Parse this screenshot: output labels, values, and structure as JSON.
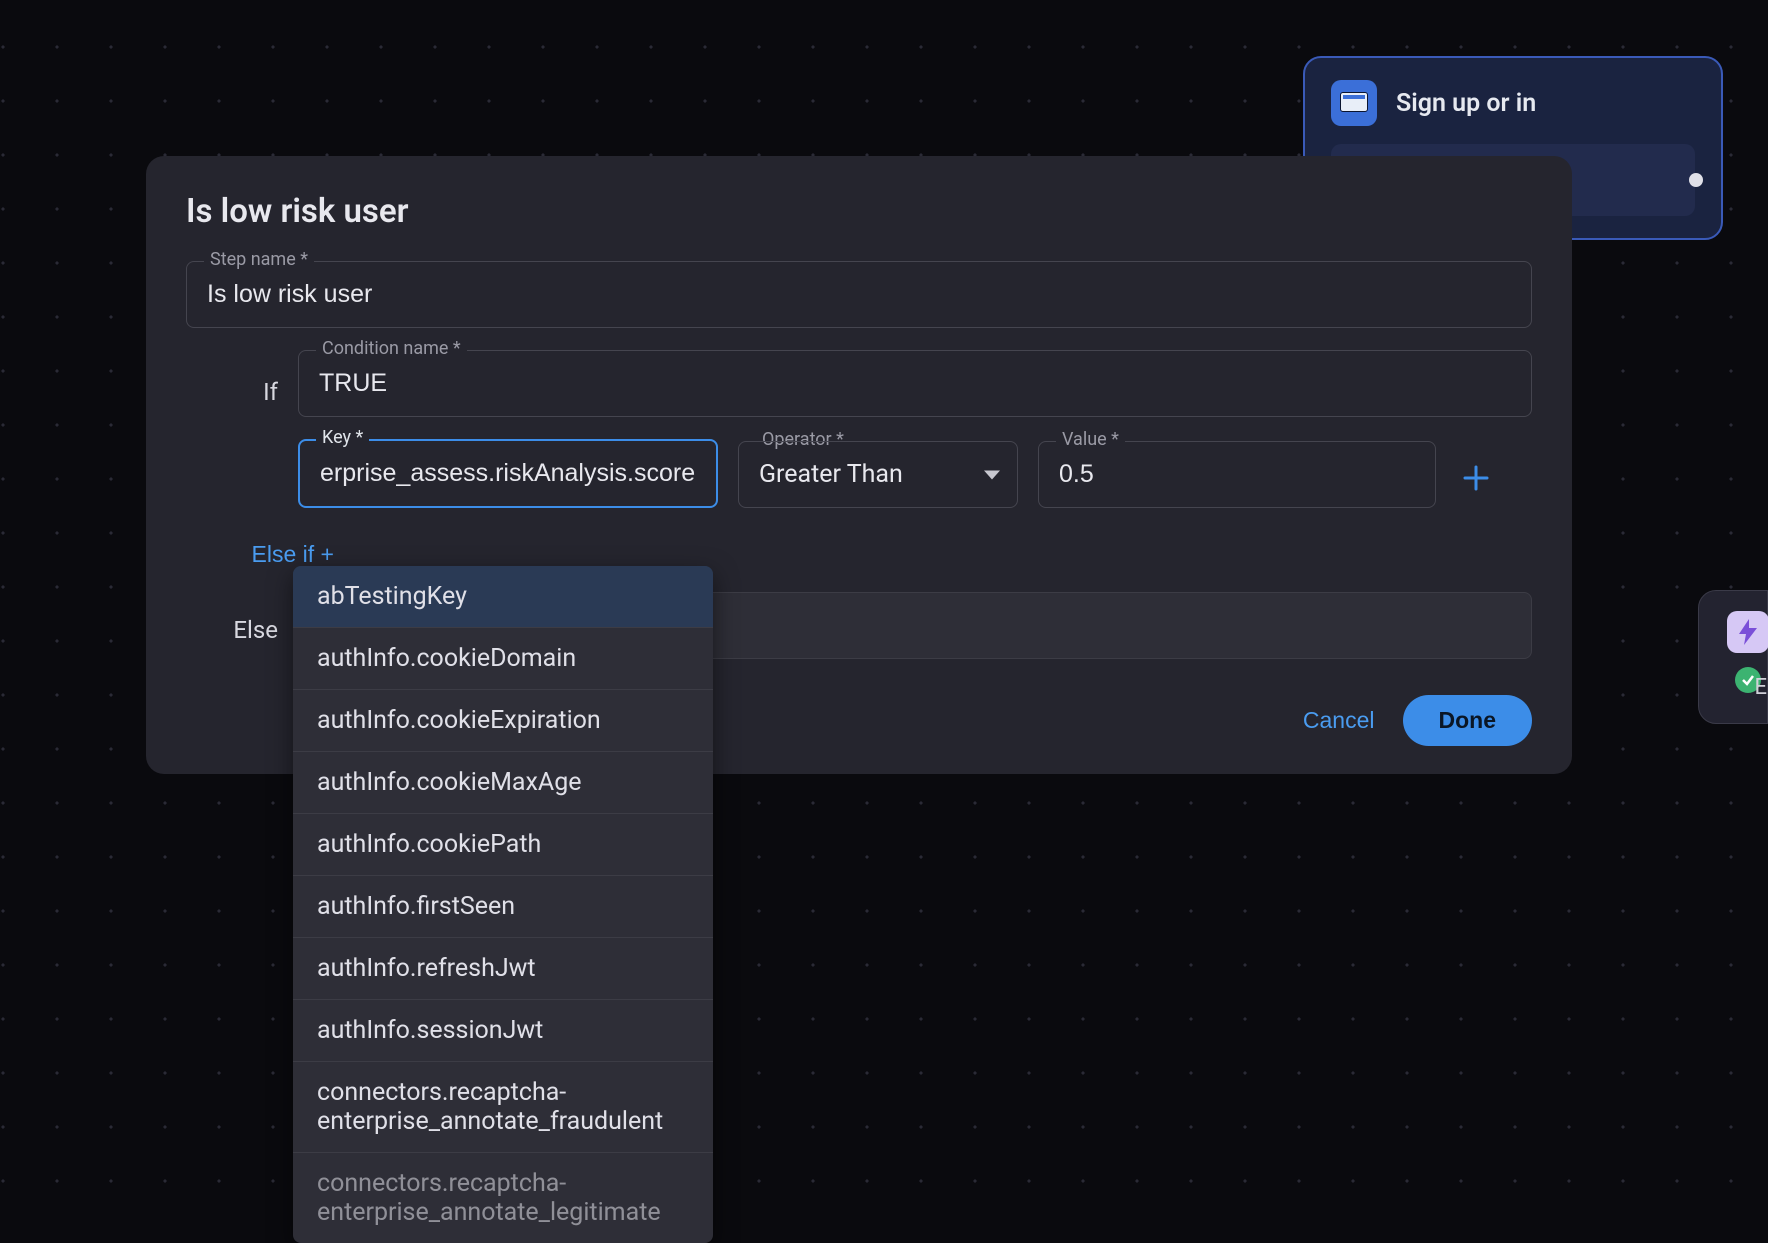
{
  "background_node": {
    "label": "Sign up or in"
  },
  "right_node": {
    "letter": "E"
  },
  "modal": {
    "title": "Is low risk user",
    "step_name_label": "Step name *",
    "step_name_value": "Is low risk user",
    "if_label": "If",
    "condition_name_label": "Condition name *",
    "condition_name_value": "TRUE",
    "key_label": "Key *",
    "key_value": "erprise_assess.riskAnalysis.score",
    "operator_label": "Operator *",
    "operator_value": "Greater Than",
    "value_label": "Value *",
    "value_value": "0.5",
    "elseif_label": "Else if +",
    "else_label": "Else",
    "else_value": "",
    "cancel_label": "Cancel",
    "done_label": "Done"
  },
  "autocomplete": {
    "options": [
      "abTestingKey",
      "authInfo.cookieDomain",
      "authInfo.cookieExpiration",
      "authInfo.cookieMaxAge",
      "authInfo.cookiePath",
      "authInfo.firstSeen",
      "authInfo.refreshJwt",
      "authInfo.sessionJwt",
      "connectors.recaptcha-enterprise_annotate_fraudulent",
      "connectors.recaptcha-enterprise_annotate_legitimate"
    ],
    "highlighted_index": 0
  }
}
